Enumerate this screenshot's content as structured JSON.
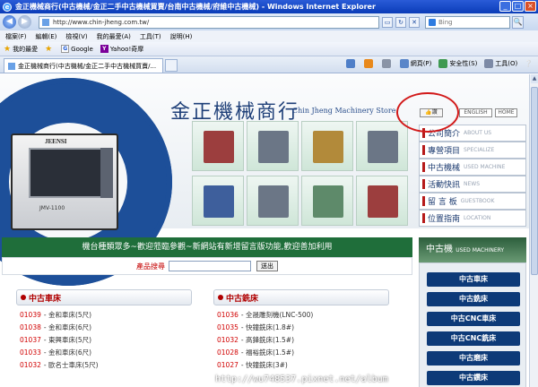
{
  "window": {
    "title": "金正機械商行(中古機械/金正二手中古機械買賣/台南中古機械/府維中古機械) - Windows Internet Explorer",
    "minimize_label": "_",
    "maximize_label": "□",
    "close_label": "×"
  },
  "address": {
    "back_label": "◀",
    "forward_label": "▶",
    "url": "http://www.chin-jheng.com.tw/",
    "search_placeholder": "Bing",
    "go_label": "🔍"
  },
  "menu": [
    "檔案(F)",
    "編輯(E)",
    "檢視(V)",
    "我的最愛(A)",
    "工具(T)",
    "說明(H)"
  ],
  "favorites": {
    "label": "我的最愛",
    "items": [
      {
        "label": "Google",
        "icon": "google-icon"
      },
      {
        "label": "Yahoo!奇摩",
        "icon": "yahoo-icon"
      }
    ]
  },
  "tab": {
    "label": "金正機械商行(中古機械/金正二手中古機械買賣/..."
  },
  "commands": [
    {
      "label": "網頁(P)",
      "icon": "page-icon",
      "color": "#5a86c9"
    },
    {
      "label": "安全性(S)",
      "icon": "shield-icon",
      "color": "#3f9a52"
    },
    {
      "label": "工具(O)",
      "icon": "gear-icon",
      "color": "#7c8aa6"
    },
    {
      "label": "❔",
      "icon": "help-icon",
      "color": "#2f64c8"
    }
  ],
  "site": {
    "name_zh": "金正機械商行",
    "name_en": "Chin Jheng Machinery Store",
    "like_label": "👍讚",
    "lang_buttons": [
      "ENGLISH",
      "HOME"
    ],
    "machine_brand": "JEENSI",
    "machine_model": "JMV-1100",
    "side_menu": [
      {
        "zh": "公司簡介",
        "en": "ABOUT US"
      },
      {
        "zh": "專營項目",
        "en": "SPECIALIZE"
      },
      {
        "zh": "中古機械",
        "en": "USED MACHINE"
      },
      {
        "zh": "活動快訊",
        "en": "NEWS"
      },
      {
        "zh": "留 言 板",
        "en": "GUESTBOOK"
      },
      {
        "zh": "位置指南",
        "en": "LOCATION"
      }
    ],
    "marquee": "機台種類眾多~歡迎蒞臨參觀~新網站有新增留言版功能,歡迎善加利用",
    "search_label": "產品搜尋",
    "search_button": "送出",
    "categories": [
      {
        "title": "中古車床",
        "items": [
          {
            "code": "01039",
            "name": "- 金和車床(5尺)"
          },
          {
            "code": "01038",
            "name": "- 金和車床(6尺)"
          },
          {
            "code": "01037",
            "name": "- 東興車床(5尺)"
          },
          {
            "code": "01033",
            "name": "- 金和車床(6尺)"
          },
          {
            "code": "01032",
            "name": "- 歐名士車床(5尺)"
          }
        ]
      },
      {
        "title": "中古銑床",
        "items": [
          {
            "code": "01036",
            "name": "- 全晟雕刻機(LNC-500)"
          },
          {
            "code": "01035",
            "name": "- 快鐘銑床(1.8#)"
          },
          {
            "code": "01032",
            "name": "- 高鋒銑床(1.5#)"
          },
          {
            "code": "01028",
            "name": "- 福裕銑床(1.5#)"
          },
          {
            "code": "01027",
            "name": "- 快鐘銑床(3#)"
          }
        ]
      }
    ],
    "used_header_zh": "中古機",
    "used_header_en": "USED MACHINERY",
    "used_buttons": [
      "中古車床",
      "中古銑床",
      "中古CNC車床",
      "中古CNC銑床",
      "中古磨床",
      "中古鑽床"
    ]
  },
  "watermark": "http://wu748537.pixnet.net/album",
  "colors": {
    "accent": "#1d4f99",
    "marquee_bg": "#1f6e3a",
    "highlight_ring": "#d21a1a",
    "used_button": "#0d3a78"
  }
}
